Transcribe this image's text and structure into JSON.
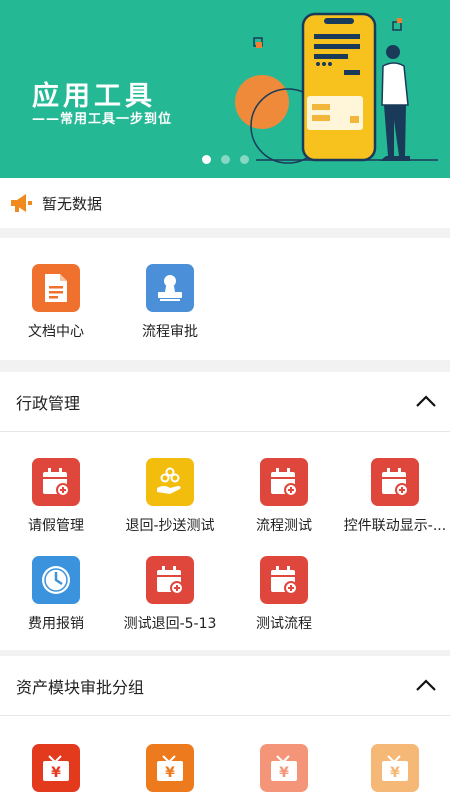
{
  "banner": {
    "title": "应用工具",
    "subtitle": "——常用工具一步到位",
    "dots": 3,
    "active_dot": 0
  },
  "notice": {
    "text": "暂无数据"
  },
  "quick_apps": [
    {
      "label": "文档中心",
      "icon": "document-icon",
      "color": "#f0712e"
    },
    {
      "label": "流程审批",
      "icon": "stamp-icon",
      "color": "#4a8fd8"
    }
  ],
  "groups": [
    {
      "title": "行政管理",
      "expanded": true,
      "items": [
        {
          "label": "请假管理",
          "icon": "calendar-add-icon",
          "color": "#e0473c"
        },
        {
          "label": "退回-抄送测试",
          "icon": "hand-coins-icon",
          "color": "#f3bd0e"
        },
        {
          "label": "流程测试",
          "icon": "calendar-add-icon",
          "color": "#e0473c"
        },
        {
          "label": "控件联动显示-...",
          "icon": "calendar-add-icon",
          "color": "#e0473c"
        },
        {
          "label": "费用报销",
          "icon": "clock-icon",
          "color": "#3a93dc"
        },
        {
          "label": "测试退回-5-13",
          "icon": "calendar-add-icon",
          "color": "#e0473c"
        },
        {
          "label": "测试流程",
          "icon": "calendar-add-icon",
          "color": "#e0473c"
        }
      ]
    },
    {
      "title": "资产模块审批分组",
      "expanded": true,
      "items": [
        {
          "label": "",
          "icon": "yuan-gift-icon",
          "color": "#e33a1e"
        },
        {
          "label": "",
          "icon": "yuan-gift-icon",
          "color": "#ee7a1e"
        },
        {
          "label": "",
          "icon": "yuan-gift-icon",
          "color": "#f4957a"
        },
        {
          "label": "",
          "icon": "yuan-gift-icon",
          "color": "#f6b877"
        }
      ]
    }
  ]
}
